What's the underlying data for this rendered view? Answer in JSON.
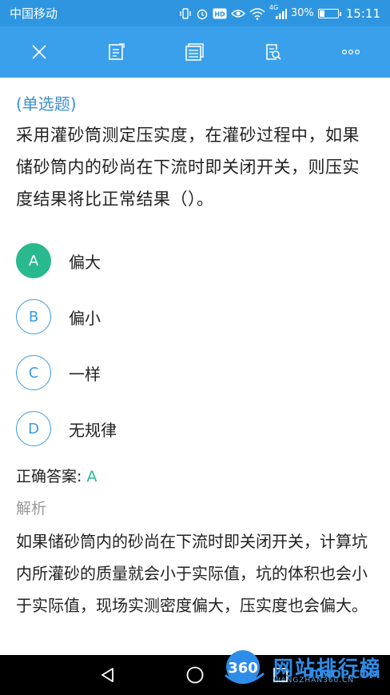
{
  "status_bar": {
    "carrier": "中国移动",
    "network": "4G",
    "battery": "30%",
    "battery_level": 0.3,
    "time": "15:11"
  },
  "toolbar": {
    "icons": [
      "close-icon",
      "note-icon",
      "card-icon",
      "search-doc-icon",
      "more-icon"
    ]
  },
  "question": {
    "type": "(单选题)",
    "text": "采用灌砂筒测定压实度，在灌砂过程中，如果储砂筒内的砂尚在下流时即关闭开关，则压实度结果将比正常结果（）。",
    "options": [
      {
        "letter": "A",
        "text": "偏大",
        "selected": true
      },
      {
        "letter": "B",
        "text": "偏小",
        "selected": false
      },
      {
        "letter": "C",
        "text": "一样",
        "selected": false
      },
      {
        "letter": "D",
        "text": "无规律",
        "selected": false
      }
    ],
    "answer_label": "正确答案: ",
    "answer_value": "A",
    "analysis_title": "解析",
    "analysis_text": "如果储砂筒内的砂尚在下流时即关闭开关，计算坑内所灌砂的质量就会小于实际值，坑的体积也会小于实际值，现场实测密度偏大，压实度也会偏大。"
  },
  "watermark": {
    "logo_text": "360",
    "title": "网站排行榜",
    "badge": "ITMOP.COM",
    "url": "WANGZHAN360.CN"
  },
  "colors": {
    "toolbar": "#3aa0ec",
    "accent": "#3a9be4",
    "correct": "#28b98f"
  }
}
